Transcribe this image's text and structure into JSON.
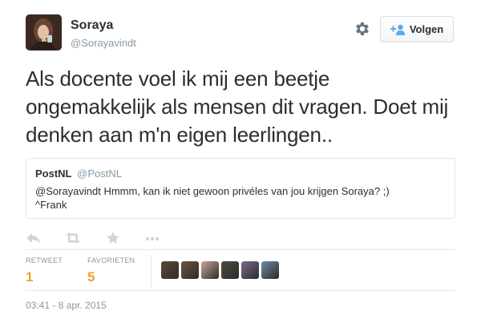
{
  "author": {
    "name": "Soraya",
    "handle": "@Sorayavindt"
  },
  "header": {
    "follow_label": "Volgen"
  },
  "tweet": {
    "text": "Als docente voel ik mij een beetje ongemakkelijk als mensen dit vragen. Doet mij denken aan m'n eigen leerlingen.."
  },
  "quoted_tweet": {
    "name": "PostNL",
    "handle": "@PostNL",
    "text": "@Sorayavindt Hmmm, kan ik niet gewoon privéles van jou krijgen Soraya? ;)\n^Frank"
  },
  "actions": {
    "icons": [
      "reply-icon",
      "retweet-icon",
      "favorite-icon",
      "more-icon"
    ]
  },
  "stats": {
    "retweets_label": "RETWEET",
    "retweets_count": "1",
    "favorites_label": "FAVORIETEN",
    "favorites_count": "5"
  },
  "favoriters": {
    "count": 6,
    "avatar_colors": [
      "#5b4a3a",
      "#6e5340",
      "#c9a596",
      "#4a4e3c",
      "#7d6a8a",
      "#6f8aa6"
    ]
  },
  "timestamp": "03:41 - 8 apr. 2015",
  "colors": {
    "accent_orange": "#e8a33a",
    "muted_gray": "#8899a6",
    "follow_icon_blue": "#55acee",
    "border": "#e1e8ed"
  }
}
